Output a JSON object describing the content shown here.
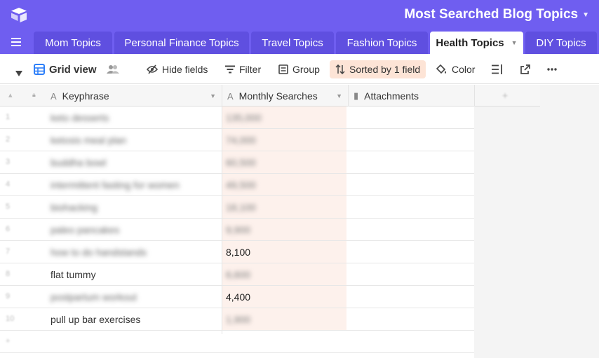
{
  "header": {
    "base_title": "Most Searched Blog Topics"
  },
  "tabs": [
    {
      "label": "Mom Topics"
    },
    {
      "label": "Personal Finance Topics"
    },
    {
      "label": "Travel Topics"
    },
    {
      "label": "Fashion Topics"
    },
    {
      "label": "Health Topics",
      "active": true
    },
    {
      "label": "DIY Topics"
    }
  ],
  "toolbar": {
    "view_name": "Grid view",
    "hide_fields": "Hide fields",
    "filter": "Filter",
    "group": "Group",
    "sorted": "Sorted by 1 field",
    "color": "Color"
  },
  "columns": {
    "keyphrase": "Keyphrase",
    "monthly_searches": "Monthly Searches",
    "attachments": "Attachments"
  },
  "rows": [
    {
      "num": "1",
      "keyphrase": "keto desserts",
      "searches": "135,000",
      "blur": true
    },
    {
      "num": "2",
      "keyphrase": "ketosis meal plan",
      "searches": "74,000",
      "blur": true
    },
    {
      "num": "3",
      "keyphrase": "buddha bowl",
      "searches": "60,500",
      "blur": true
    },
    {
      "num": "4",
      "keyphrase": "intermittent fasting for women",
      "searches": "49,500",
      "blur": true
    },
    {
      "num": "5",
      "keyphrase": "biohacking",
      "searches": "18,100",
      "blur": true
    },
    {
      "num": "6",
      "keyphrase": "paleo pancakes",
      "searches": "9,900",
      "blur": true
    },
    {
      "num": "7",
      "keyphrase": "how to do handstands",
      "searches": "8,100",
      "blur": true,
      "searches_clear": true
    },
    {
      "num": "8",
      "keyphrase": "flat tummy",
      "searches": "6,600",
      "blur": false,
      "searches_blur": true
    },
    {
      "num": "9",
      "keyphrase": "postpartum workout",
      "searches": "4,400",
      "blur": true,
      "searches_clear": true
    },
    {
      "num": "10",
      "keyphrase": "pull up bar exercises",
      "searches": "1,900",
      "blur": false,
      "searches_blur": true
    },
    {
      "num": "+",
      "keyphrase": "",
      "searches": "",
      "blur": true
    }
  ],
  "colors": {
    "brand": "#6f5ef0",
    "sorted_bg": "#fde4d6",
    "sort_col_bg": "#fdf1ec"
  }
}
